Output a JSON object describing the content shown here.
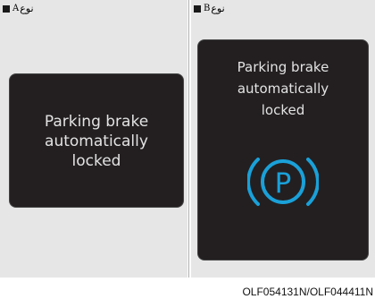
{
  "panels": {
    "a": {
      "type_word": "نوع",
      "type_letter": "A",
      "message": "Parking brake\nautomatically\nlocked"
    },
    "b": {
      "type_word": "نوع",
      "type_letter": "B",
      "message": "Parking brake\nautomatically\nlocked",
      "icon": "parking-brake-icon",
      "icon_color": "#1aa0d8"
    }
  },
  "colors": {
    "panel_bg": "#e6e6e6",
    "display_bg": "#231f20",
    "message_text": "#e3e3e3"
  },
  "figure_code": "OLF054131N/OLF044411N"
}
